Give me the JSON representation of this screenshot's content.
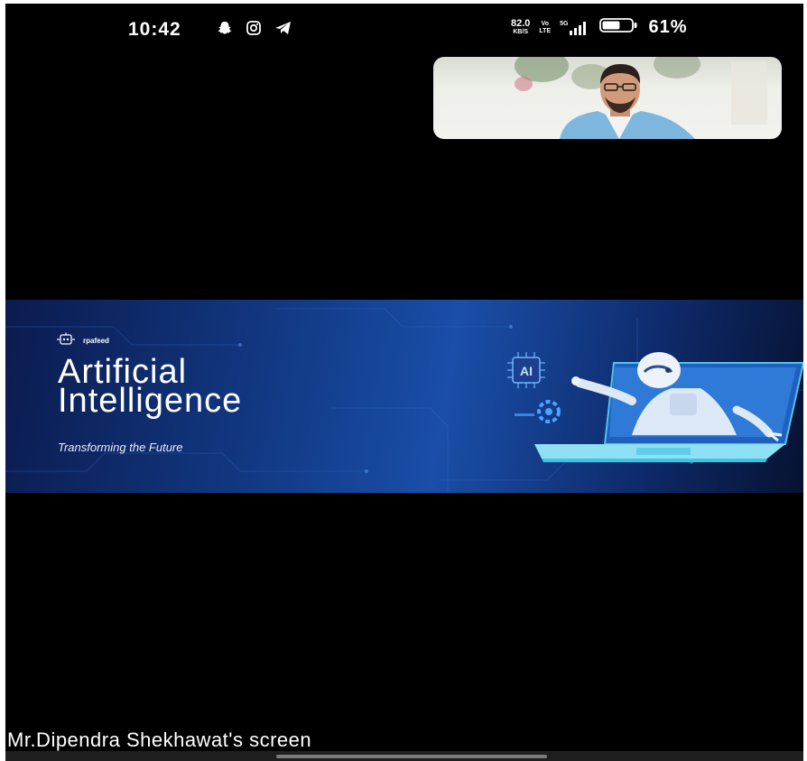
{
  "status_bar": {
    "time": "10:42",
    "net_speed_value": "82.0",
    "net_speed_unit": "KB/S",
    "volte_top": "Vo",
    "volte_bottom": "LTE",
    "network_type": "5G",
    "battery_percent": "61%",
    "battery_level": 0.61,
    "left_icons": [
      "snapchat-icon",
      "instagram-icon",
      "telegram-icon"
    ]
  },
  "call": {
    "presenter_caption": "Mr.Dipendra Shekhawat's screen"
  },
  "slide": {
    "brand": "rpafeed",
    "title": "Artificial\nIntelligence",
    "subtitle": "Transforming the Future",
    "chip_label": "AI"
  },
  "colors": {
    "background": "#000000",
    "slide_blue": "#123a86",
    "laptop_cyan": "#39c6e6"
  }
}
